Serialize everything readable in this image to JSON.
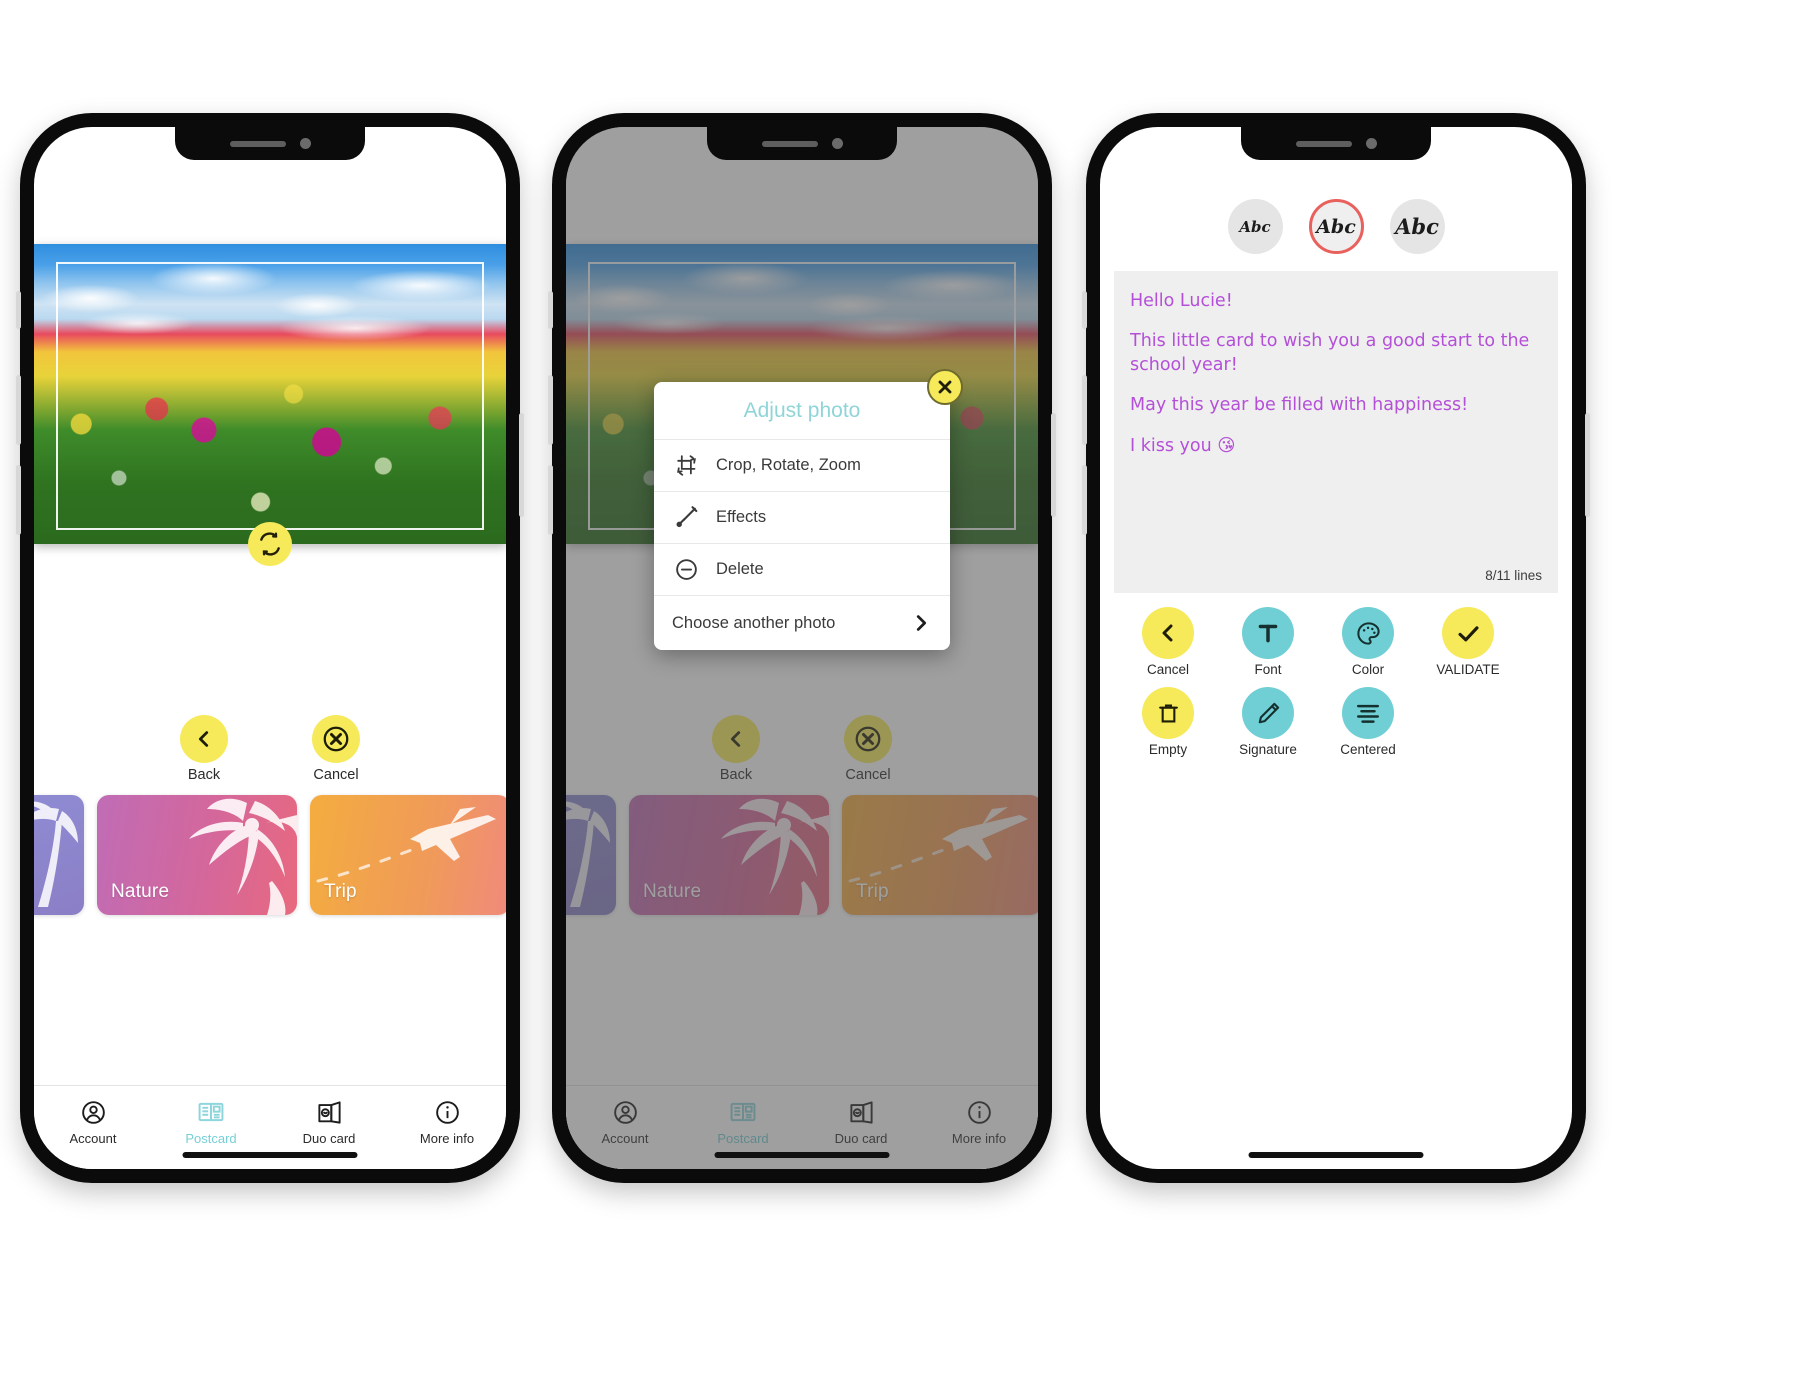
{
  "phone1": {
    "name": "postcard-photo-step",
    "photo": {
      "alt": "tulip-and-daffodil-field",
      "crop_frame": true,
      "rotate_icon": "rotate-icon"
    },
    "actions": [
      {
        "id": "back",
        "label": "Back",
        "icon": "chevron-left-icon",
        "color": "#f6ea5a"
      },
      {
        "id": "cancel",
        "label": "Cancel",
        "icon": "circle-x-icon",
        "color": "#f6ea5a"
      }
    ],
    "themes": [
      {
        "id": "beach",
        "label": "",
        "art": "palm-tree-art"
      },
      {
        "id": "nature",
        "label": "Nature",
        "art": "flower-art"
      },
      {
        "id": "trip",
        "label": "Trip",
        "art": "airplane-art"
      }
    ],
    "tabs": [
      {
        "id": "account",
        "label": "Account",
        "icon": "account-circle-icon",
        "active": false
      },
      {
        "id": "postcard",
        "label": "Postcard",
        "icon": "postcard-icon",
        "active": true
      },
      {
        "id": "duocard",
        "label": "Duo card",
        "icon": "duo-card-icon",
        "active": false
      },
      {
        "id": "moreinfo",
        "label": "More info",
        "icon": "info-circle-icon",
        "active": false
      }
    ]
  },
  "phone2": {
    "name": "adjust-photo-dialog-step",
    "modal": {
      "title": "Adjust photo",
      "close_icon": "close-x-icon",
      "items": [
        {
          "id": "crop-rotate-zoom",
          "label": "Crop, Rotate, Zoom",
          "icon": "crop-rotate-icon"
        },
        {
          "id": "effects",
          "label": "Effects",
          "icon": "brush-icon"
        },
        {
          "id": "delete",
          "label": "Delete",
          "icon": "minus-circle-icon"
        }
      ],
      "footer": {
        "id": "choose-another-photo",
        "label": "Choose another photo",
        "icon": "chevron-right-icon"
      }
    },
    "actions": [
      {
        "id": "back",
        "label": "Back",
        "icon": "chevron-left-icon"
      },
      {
        "id": "cancel",
        "label": "Cancel",
        "icon": "circle-x-icon"
      }
    ],
    "themes": [
      {
        "id": "beach",
        "label": ""
      },
      {
        "id": "nature",
        "label": "Nature"
      },
      {
        "id": "trip",
        "label": "Trip"
      }
    ],
    "tabs": [
      {
        "id": "account",
        "label": "Account",
        "active": false
      },
      {
        "id": "postcard",
        "label": "Postcard",
        "active": true
      },
      {
        "id": "duocard",
        "label": "Duo card",
        "active": false
      },
      {
        "id": "moreinfo",
        "label": "More info",
        "active": false
      }
    ]
  },
  "phone3": {
    "name": "postcard-text-step",
    "font_chips": [
      {
        "id": "font-1",
        "label": "Abc",
        "selected": false
      },
      {
        "id": "font-2",
        "label": "Abc",
        "selected": true
      },
      {
        "id": "font-3",
        "label": "Abc",
        "selected": false
      }
    ],
    "selected_chip_color": "#e8615c",
    "message": {
      "line1": "Hello Lucie!",
      "line2": "This little card to wish you a good start to the school year!",
      "line3": "May this year be filled with happiness!",
      "line4": "I kiss you  😘",
      "text_color": "#b44fd8",
      "line_counter": "8/11 lines"
    },
    "tools": [
      {
        "id": "cancel",
        "label": "Cancel",
        "icon": "chevron-left-icon",
        "color": "#f6ea5a"
      },
      {
        "id": "font",
        "label": "Font",
        "icon": "text-t-icon",
        "color": "#6fcfd4"
      },
      {
        "id": "color",
        "label": "Color",
        "icon": "palette-icon",
        "color": "#6fcfd4"
      },
      {
        "id": "validate",
        "label": "VALIDATE",
        "icon": "check-icon",
        "color": "#f6ea5a"
      },
      {
        "id": "empty",
        "label": "Empty",
        "icon": "trash-icon",
        "color": "#f6ea5a"
      },
      {
        "id": "signature",
        "label": "Signature",
        "icon": "pencil-icon",
        "color": "#6fcfd4"
      },
      {
        "id": "centered",
        "label": "Centered",
        "icon": "align-center-icon",
        "color": "#6fcfd4"
      }
    ]
  }
}
